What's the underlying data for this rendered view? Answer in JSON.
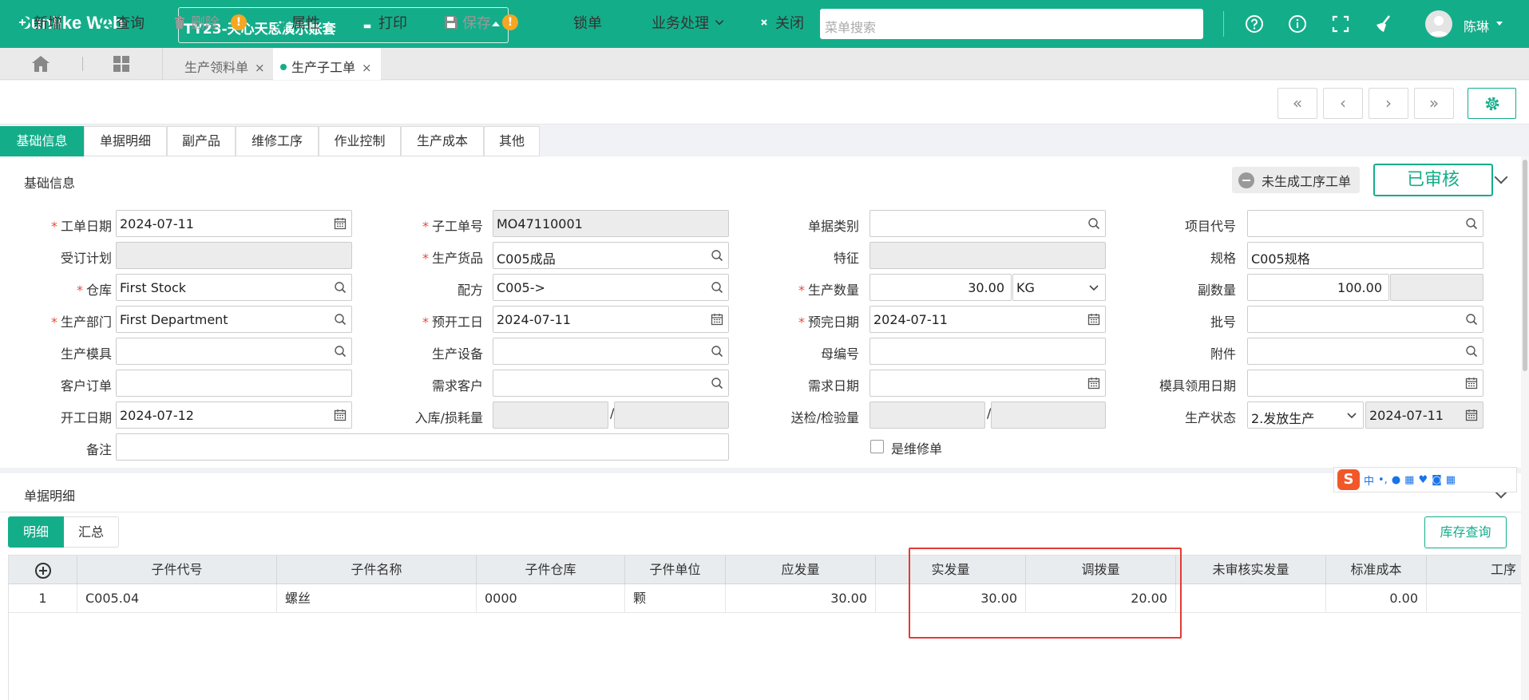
{
  "app": {
    "brand": "Sunlike Web",
    "account": "TY23-天心天思演示账套",
    "search_placeholder": "菜单搜索",
    "user": "陈琳",
    "accent": "#14ad8a"
  },
  "tabs": {
    "items": [
      {
        "label": "生产领料单",
        "active": false
      },
      {
        "label": "生产子工单",
        "active": true
      }
    ],
    "close": "×"
  },
  "toolbar": {
    "new": "新增",
    "query": "查询",
    "delete": "删除",
    "props": "属性",
    "print": "打印",
    "save": "保存",
    "lock": "锁单",
    "business": "业务处理",
    "close": "关闭",
    "warn": "!",
    "nav": [
      "«",
      "‹",
      "›",
      "»"
    ]
  },
  "subtabs": [
    "基础信息",
    "单据明细",
    "副产品",
    "维修工序",
    "作业控制",
    "生产成本",
    "其他"
  ],
  "basic": {
    "title": "基础信息",
    "gen_status": "未生成工序工单",
    "audit_status": "已审核",
    "required_mark": "*",
    "fields": {
      "work_date": {
        "label": "工单日期",
        "value": "2024-07-11"
      },
      "sub_order_no": {
        "label": "子工单号",
        "value": "MO47110001"
      },
      "doc_type": {
        "label": "单据类别",
        "value": ""
      },
      "project_code": {
        "label": "项目代号",
        "value": ""
      },
      "order_plan": {
        "label": "受订计划",
        "value": ""
      },
      "product": {
        "label": "生产货品",
        "value": "C005成品"
      },
      "feature": {
        "label": "特征",
        "value": ""
      },
      "spec": {
        "label": "规格",
        "value": "C005规格"
      },
      "warehouse": {
        "label": "仓库",
        "value": "First Stock"
      },
      "formula": {
        "label": "配方",
        "value": "C005->"
      },
      "prod_qty": {
        "label": "生产数量",
        "value": "30.00",
        "unit": "KG"
      },
      "sub_qty": {
        "label": "副数量",
        "value": "100.00"
      },
      "dept": {
        "label": "生产部门",
        "value": "First Department"
      },
      "plan_start": {
        "label": "预开工日",
        "value": "2024-07-11"
      },
      "plan_end": {
        "label": "预完日期",
        "value": "2024-07-11"
      },
      "batch": {
        "label": "批号",
        "value": ""
      },
      "mold": {
        "label": "生产模具",
        "value": ""
      },
      "equipment": {
        "label": "生产设备",
        "value": ""
      },
      "parent_no": {
        "label": "母编号",
        "value": ""
      },
      "attachment": {
        "label": "附件",
        "value": ""
      },
      "cust_order": {
        "label": "客户订单",
        "value": ""
      },
      "demand_cust": {
        "label": "需求客户",
        "value": ""
      },
      "demand_date": {
        "label": "需求日期",
        "value": ""
      },
      "mold_date": {
        "label": "模具领用日期",
        "value": ""
      },
      "start_date": {
        "label": "开工日期",
        "value": "2024-07-12"
      },
      "in_loss": {
        "label": "入库/损耗量",
        "value1": "",
        "value2": ""
      },
      "inspect": {
        "label": "送检/检验量",
        "value1": "",
        "value2": ""
      },
      "prod_status": {
        "label": "生产状态",
        "value": "2.发放生产",
        "date": "2024-07-11"
      },
      "remark": {
        "label": "备注",
        "value": ""
      },
      "repair": {
        "label": "是维修单"
      }
    },
    "slash": "/"
  },
  "detail": {
    "title": "单据明细",
    "views": [
      "明细",
      "汇总"
    ],
    "stock_query": "库存查询",
    "columns": [
      "子件代号",
      "子件名称",
      "子件仓库",
      "子件单位",
      "应发量",
      "实发量",
      "调拨量",
      "未审核实发量",
      "标准成本",
      "工序"
    ],
    "rows": [
      {
        "idx": "1",
        "code": "C005.04",
        "name": "螺丝",
        "wh": "0000",
        "unit": "颗",
        "should": "30.00",
        "actual": "30.00",
        "transfer": "20.00",
        "unaudited": "",
        "cost": "0.00",
        "proc": ""
      }
    ]
  },
  "ime": {
    "logo": "S",
    "lang": "中",
    "punct": "•,"
  }
}
